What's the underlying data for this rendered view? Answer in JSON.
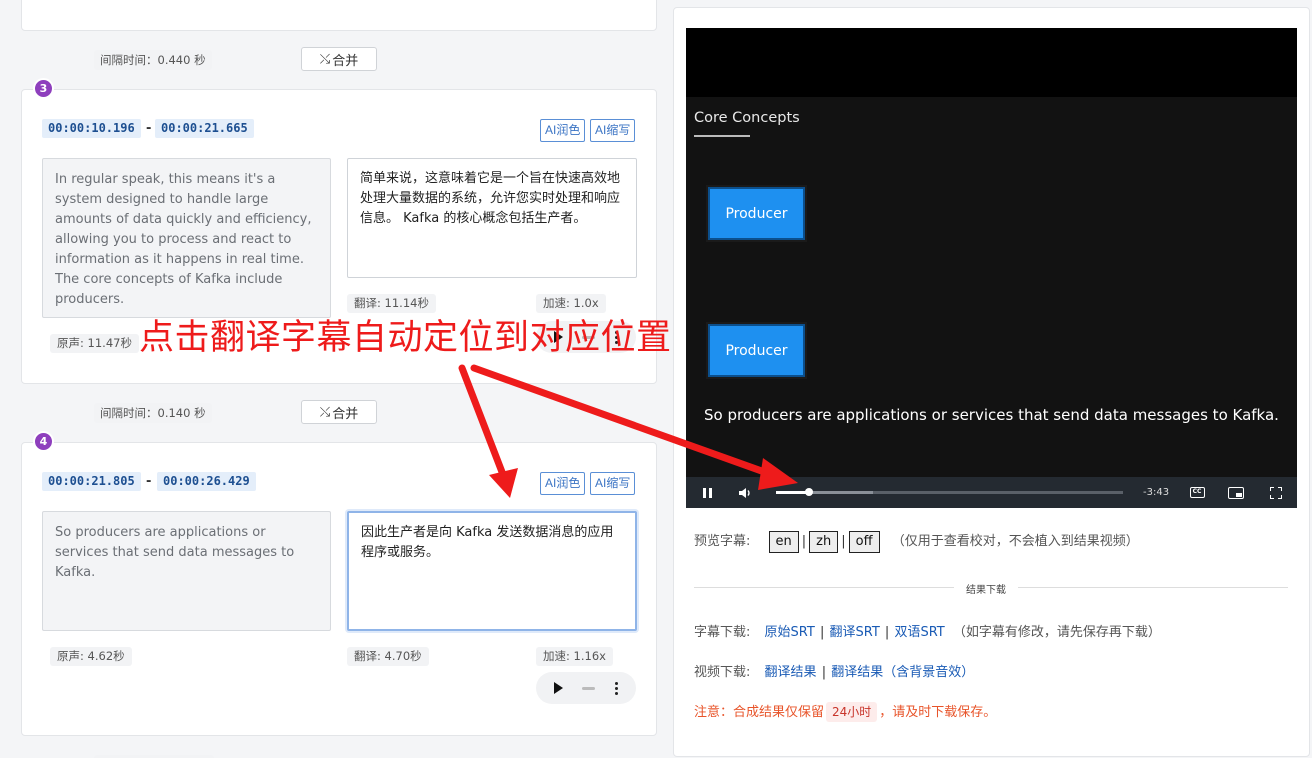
{
  "gap_1": {
    "label": "间隔时间：0.440 秒",
    "merge_label": "合并"
  },
  "segment_3": {
    "index": "3",
    "start": "00:00:10.196",
    "end": "00:00:21.665",
    "ai_polish": "AI润色",
    "ai_shorten": "AI缩写",
    "source_text": "In regular speak, this means it's a system designed to handle large amounts of data quickly and efficiency, allowing you to process and react to information as it happens in real time. The core concepts of Kafka include producers.",
    "translation_text": "简单来说，这意味着它是一个旨在快速高效地处理大量数据的系统，允许您实时处理和响应信息。 Kafka 的核心概念包括生产者。",
    "orig_duration": "原声: 11.47秒",
    "trans_duration": "翻译: 11.14秒",
    "speed": "加速: 1.0x"
  },
  "gap_2": {
    "label": "间隔时间：0.140 秒",
    "merge_label": "合并"
  },
  "segment_4": {
    "index": "4",
    "start": "00:00:21.805",
    "end": "00:00:26.429",
    "ai_polish": "AI润色",
    "ai_shorten": "AI缩写",
    "source_text": "So producers are applications or services that send data messages to Kafka.",
    "translation_text": "因此生产者是向 Kafka 发送数据消息的应用程序或服务。",
    "orig_duration": "原声: 4.62秒",
    "trans_duration": "翻译: 4.70秒",
    "speed": "加速: 1.16x"
  },
  "video": {
    "slide_title": "Core Concepts",
    "boxes": [
      "Producer",
      "Producer"
    ],
    "caption": "So producers are applications or services that send data messages to Kafka.",
    "time_remaining": "-3:43",
    "cc_label": "CC",
    "progress_fraction": 0.095,
    "buffered_fraction": 0.28
  },
  "preview": {
    "label": "预览字幕:",
    "options": [
      "en",
      "zh",
      "off"
    ],
    "note": "（仅用于查看校对，不会植入到结果视频）"
  },
  "results_divider": "结果下载",
  "subtitle_download": {
    "label": "字幕下载:",
    "links": [
      "原始SRT",
      "翻译SRT",
      "双语SRT"
    ],
    "note": "（如字幕有修改，请先保存再下载）"
  },
  "video_download": {
    "label": "视频下载:",
    "links": [
      "翻译结果",
      "翻译结果（含背景音效）"
    ]
  },
  "notice": {
    "prefix": "注意：合成结果仅保留",
    "badge": "24小时",
    "suffix": "，请及时下载保存。"
  },
  "annotation": "点击翻译字幕自动定位到对应位置",
  "colors": {
    "accent": "#1a5bb5",
    "badge": "#8e3fbd",
    "annotation": "#ee1b1b",
    "warning": "#e8542a"
  }
}
